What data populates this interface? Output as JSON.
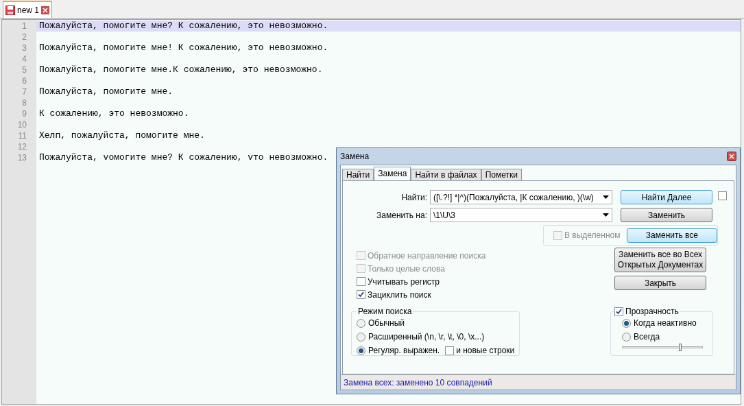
{
  "tabs": [
    {
      "label": "new 1",
      "selected": true
    }
  ],
  "editor": {
    "lines": [
      {
        "number": "1",
        "text": "Пожалуйста, помогите мне? К сожалению, это невозможно.",
        "current": true
      },
      {
        "number": "2",
        "current": false
      },
      {
        "number": "3",
        "text": "Пожалуйста, помогите мне! К сожалению, это невозможно.",
        "current": false
      },
      {
        "number": "4",
        "current": false
      },
      {
        "number": "5",
        "text": "Пожалуйста, помогите мне.К сожалению, это невозможно.",
        "current": false
      },
      {
        "number": "6",
        "current": false
      },
      {
        "number": "7",
        "text": "Пожалуйста, помогите мне.",
        "current": false
      },
      {
        "number": "8",
        "current": false
      },
      {
        "number": "9",
        "text": "К сожалению, это невозможно.",
        "current": false
      },
      {
        "number": "10",
        "current": false
      },
      {
        "number": "11",
        "text": "Хелп, пожалуйста, помогите мне.",
        "current": false
      },
      {
        "number": "12",
        "current": false
      },
      {
        "number": "13",
        "text": "Пожалуйста, vомогите мне? К сожалению, vто невозможно.",
        "current": false
      }
    ]
  },
  "dialog": {
    "title": "Замена",
    "tabs": [
      {
        "label": "Найти",
        "selected": false
      },
      {
        "label": "Замена",
        "selected": true
      },
      {
        "label": "Найти в файлах",
        "selected": false
      },
      {
        "label": "Пометки",
        "selected": false
      }
    ],
    "find": {
      "label": "Найти:",
      "value": "([\\.?!] *|^)(Пожалуйста, |К сожалению, )(\\w)"
    },
    "replace": {
      "label": "Заменить на:",
      "value": "\\1\\U\\3"
    },
    "find_next": {
      "label": "Найти Далее",
      "focused": true
    },
    "extra_checkbox": {
      "checked": false
    },
    "replace_button": {
      "label": "Заменить",
      "focused": false
    },
    "in_selection": {
      "label": "В выделенном",
      "checked": false,
      "disabled": true
    },
    "replace_all": {
      "label": "Заменить все",
      "focused": true
    },
    "replace_all_open": {
      "lines": [
        "Заменить все во Всех",
        "Открытых Документах"
      ],
      "focused": false
    },
    "close": {
      "label": "Закрыть",
      "focused": false
    },
    "options": [
      {
        "label": "Обратное направление поиска",
        "checked": false,
        "disabled": true
      },
      {
        "label": "Только целые слова",
        "checked": false,
        "disabled": true
      },
      {
        "label": "Учитывать регистр",
        "checked": false,
        "disabled": false
      },
      {
        "label": "Зациклить поиск",
        "checked": true,
        "disabled": false
      }
    ],
    "search_mode": {
      "title": "Режим поиска",
      "modes": [
        {
          "label": "Обычный",
          "selected": false
        },
        {
          "label": "Расширенный (\\n, \\r, \\t, \\0, \\x...)",
          "selected": false
        },
        {
          "label": "Регуляр. выражен.",
          "selected": true
        }
      ],
      "newlines": {
        "label": "и новые строки",
        "checked": false
      }
    },
    "transparency": {
      "label": "Прозрачность",
      "checked": true,
      "modes": [
        {
          "label": "Когда неактивно",
          "selected": true
        },
        {
          "label": "Всегда",
          "selected": false
        }
      ],
      "level": 0.72
    },
    "status": "Замена всех: заменено 10 совпадений"
  }
}
